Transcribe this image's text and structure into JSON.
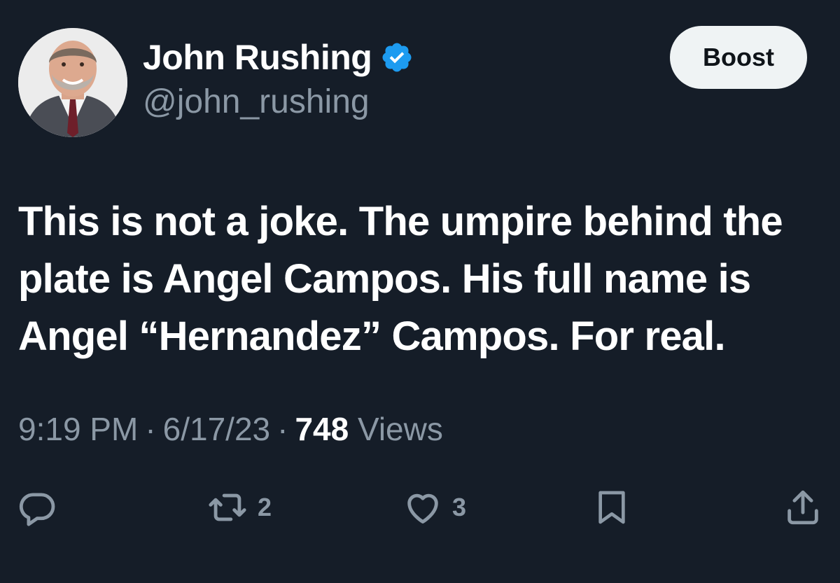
{
  "author": {
    "display_name": "John Rushing",
    "handle": "@john_rushing",
    "verified": true
  },
  "header": {
    "boost_label": "Boost"
  },
  "tweet": {
    "lines": [
      "This is not a joke. The umpire behind the",
      "plate is Angel Campos. His full name is",
      "Angel “Hernandez” Campos. For real."
    ]
  },
  "meta": {
    "time": "9:19 PM",
    "date": "6/17/23",
    "separator": "·",
    "views_count": "748",
    "views_label": "Views"
  },
  "actions": {
    "reply": {
      "icon": "reply-icon",
      "count": ""
    },
    "retweet": {
      "icon": "retweet-icon",
      "count": "2"
    },
    "like": {
      "icon": "heart-icon",
      "count": "3"
    },
    "bookmark": {
      "icon": "bookmark-icon",
      "count": ""
    },
    "share": {
      "icon": "share-icon",
      "count": ""
    }
  },
  "colors": {
    "background": "#151d28",
    "secondary_text": "#8b98a5",
    "verified_blue": "#1d9bf0",
    "boost_bg": "#eff3f4"
  }
}
